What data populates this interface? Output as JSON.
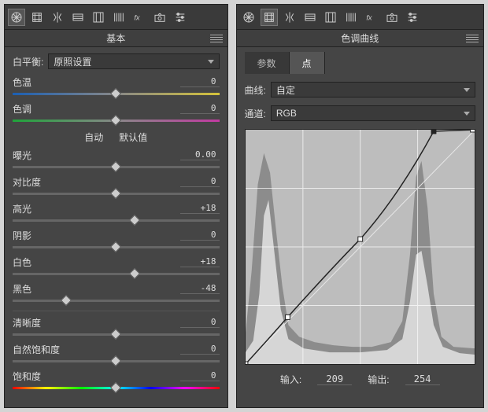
{
  "left": {
    "title": "基本",
    "white_balance": {
      "label": "白平衡:",
      "value": "原照设置"
    },
    "buttons": {
      "auto": "自动",
      "default": "默认值"
    },
    "sliders": {
      "temp": {
        "label": "色温",
        "value": "0",
        "pos": 50,
        "grad": "grad-temp"
      },
      "tint": {
        "label": "色调",
        "value": "0",
        "pos": 50,
        "grad": "grad-tint"
      },
      "exposure": {
        "label": "曝光",
        "value": "0.00",
        "pos": 50
      },
      "contrast": {
        "label": "对比度",
        "value": "0",
        "pos": 50
      },
      "highlights": {
        "label": "高光",
        "value": "+18",
        "pos": 59
      },
      "shadows": {
        "label": "阴影",
        "value": "0",
        "pos": 50
      },
      "whites": {
        "label": "白色",
        "value": "+18",
        "pos": 59
      },
      "blacks": {
        "label": "黑色",
        "value": "-48",
        "pos": 26
      },
      "clarity": {
        "label": "清晰度",
        "value": "0",
        "pos": 50
      },
      "vibrance": {
        "label": "自然饱和度",
        "value": "0",
        "pos": 50
      },
      "saturation": {
        "label": "饱和度",
        "value": "0",
        "pos": 50,
        "grad": "grad-sat"
      }
    }
  },
  "right": {
    "title": "色调曲线",
    "tabs": {
      "param": "参数",
      "point": "点"
    },
    "curve": {
      "label": "曲线:",
      "value": "自定"
    },
    "channel": {
      "label": "通道:",
      "value": "RGB"
    },
    "input": {
      "label": "输入:",
      "value": "209"
    },
    "output": {
      "label": "输出:",
      "value": "254"
    }
  }
}
